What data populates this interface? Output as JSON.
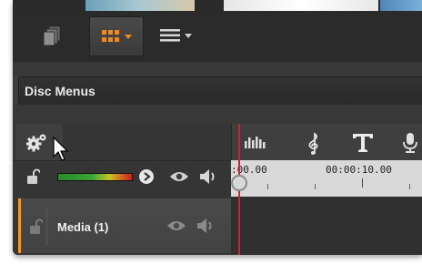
{
  "disc_menu_bar": {
    "title": "Disc Menus"
  },
  "timeline": {
    "ruler_labels": [
      ":00.00",
      "00:00:10.00"
    ]
  },
  "track": {
    "name": "Media (1)"
  },
  "colors": {
    "accent_orange": "#f39b1f",
    "playhead_red": "#c8262c",
    "background_dark": "#3c3c3c"
  },
  "icons": {
    "toolbar": [
      "stack-icon",
      "grid-view-icon",
      "list-view-icon"
    ],
    "timeline_tools": [
      "audio-levels-icon",
      "music-clef-icon",
      "title-text-icon",
      "microphone-icon"
    ],
    "header": [
      "gear-icon",
      "lock-icon",
      "play-icon",
      "eye-icon",
      "speaker-icon"
    ]
  }
}
